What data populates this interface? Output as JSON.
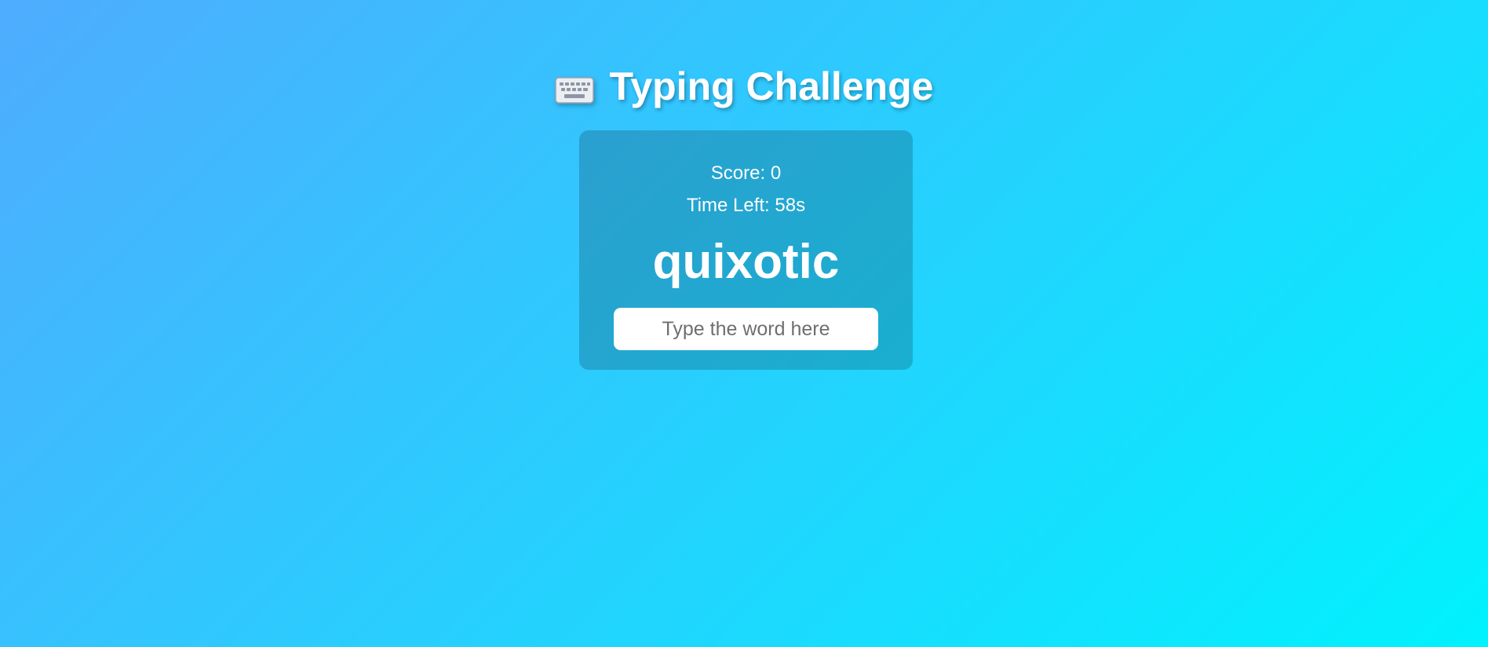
{
  "header": {
    "icon": "keyboard-icon",
    "title": "Typing Challenge"
  },
  "game": {
    "score_text": "Score: 0",
    "time_left_text": "Time Left: 58s",
    "current_word": "quixotic",
    "input": {
      "value": "",
      "placeholder": "Type the word here"
    }
  },
  "colors": {
    "background_start": "#4facfe",
    "background_end": "#00f2fe",
    "text": "#ffffff"
  }
}
